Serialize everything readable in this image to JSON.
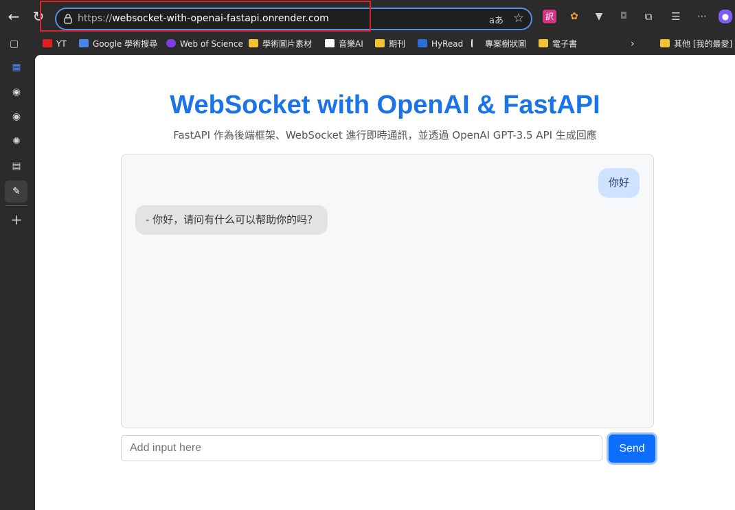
{
  "browser": {
    "url_scheme": "https://",
    "url_host": "websocket-with-openai-fastapi.onrender.com",
    "read_aloud": "aあ",
    "bookmarks": [
      {
        "label": "YT",
        "icon": "youtube-icon"
      },
      {
        "label": "Google 學術搜尋",
        "icon": "google-scholar-icon"
      },
      {
        "label": "Web of Science",
        "icon": "web-of-science-icon"
      },
      {
        "label": "學術圖片素材",
        "icon": "folder-icon"
      },
      {
        "label": "音樂AI",
        "icon": "music-ai-icon"
      },
      {
        "label": "期刊",
        "icon": "folder-icon"
      },
      {
        "label": "HyRead",
        "icon": "hyread-icon"
      },
      {
        "label": "專案樹狀圖",
        "icon": "tree-icon"
      },
      {
        "label": "電子書",
        "icon": "folder-icon"
      },
      {
        "label": "其他 [我的最愛]",
        "icon": "folder-icon"
      }
    ]
  },
  "page": {
    "title": "WebSocket with OpenAI & FastAPI",
    "subtitle": "FastAPI 作為後端框架、WebSocket 進行即時通訊，並透過 OpenAI GPT-3.5 API 生成回應",
    "messages": {
      "user": "你好",
      "bot": "- 你好，请问有什么可以帮助你的吗？"
    },
    "input_placeholder": "Add input here",
    "send_label": "Send"
  },
  "colors": {
    "title": "#1a73e8",
    "user_bubble": "#cfe2ff",
    "bot_bubble": "#e2e3e5",
    "send_button": "#0d6efd",
    "highlight": "#d9262b"
  }
}
